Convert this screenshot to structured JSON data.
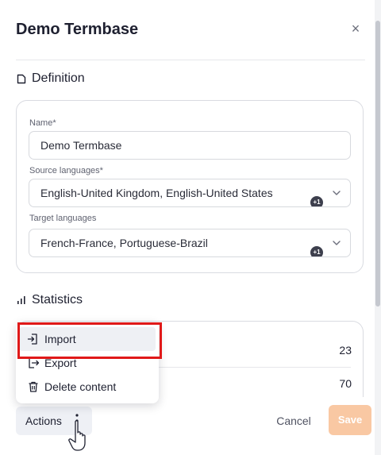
{
  "dialog": {
    "title": "Demo Termbase",
    "close_glyph": "×"
  },
  "definition": {
    "heading": "Definition",
    "icon": "document-icon",
    "name_label": "Name*",
    "name_value": "Demo Termbase",
    "source_label": "Source languages*",
    "source_value": "English-United Kingdom, English-United States",
    "source_badge": "+1",
    "target_label": "Target languages",
    "target_value": "French-France, Portuguese-Brazil",
    "target_badge": "+1"
  },
  "statistics": {
    "heading": "Statistics",
    "icon": "bar-chart-icon",
    "values": [
      "23",
      "70"
    ]
  },
  "actions_menu": {
    "items": [
      {
        "label": "Import",
        "icon": "import-icon"
      },
      {
        "label": "Export",
        "icon": "export-icon"
      },
      {
        "label": "Delete content",
        "icon": "trash-icon"
      }
    ]
  },
  "footer": {
    "actions_label": "Actions",
    "cancel_label": "Cancel",
    "save_label": "Save"
  },
  "colors": {
    "highlight": "#e01919",
    "save_disabled": "#f9c8a3"
  }
}
